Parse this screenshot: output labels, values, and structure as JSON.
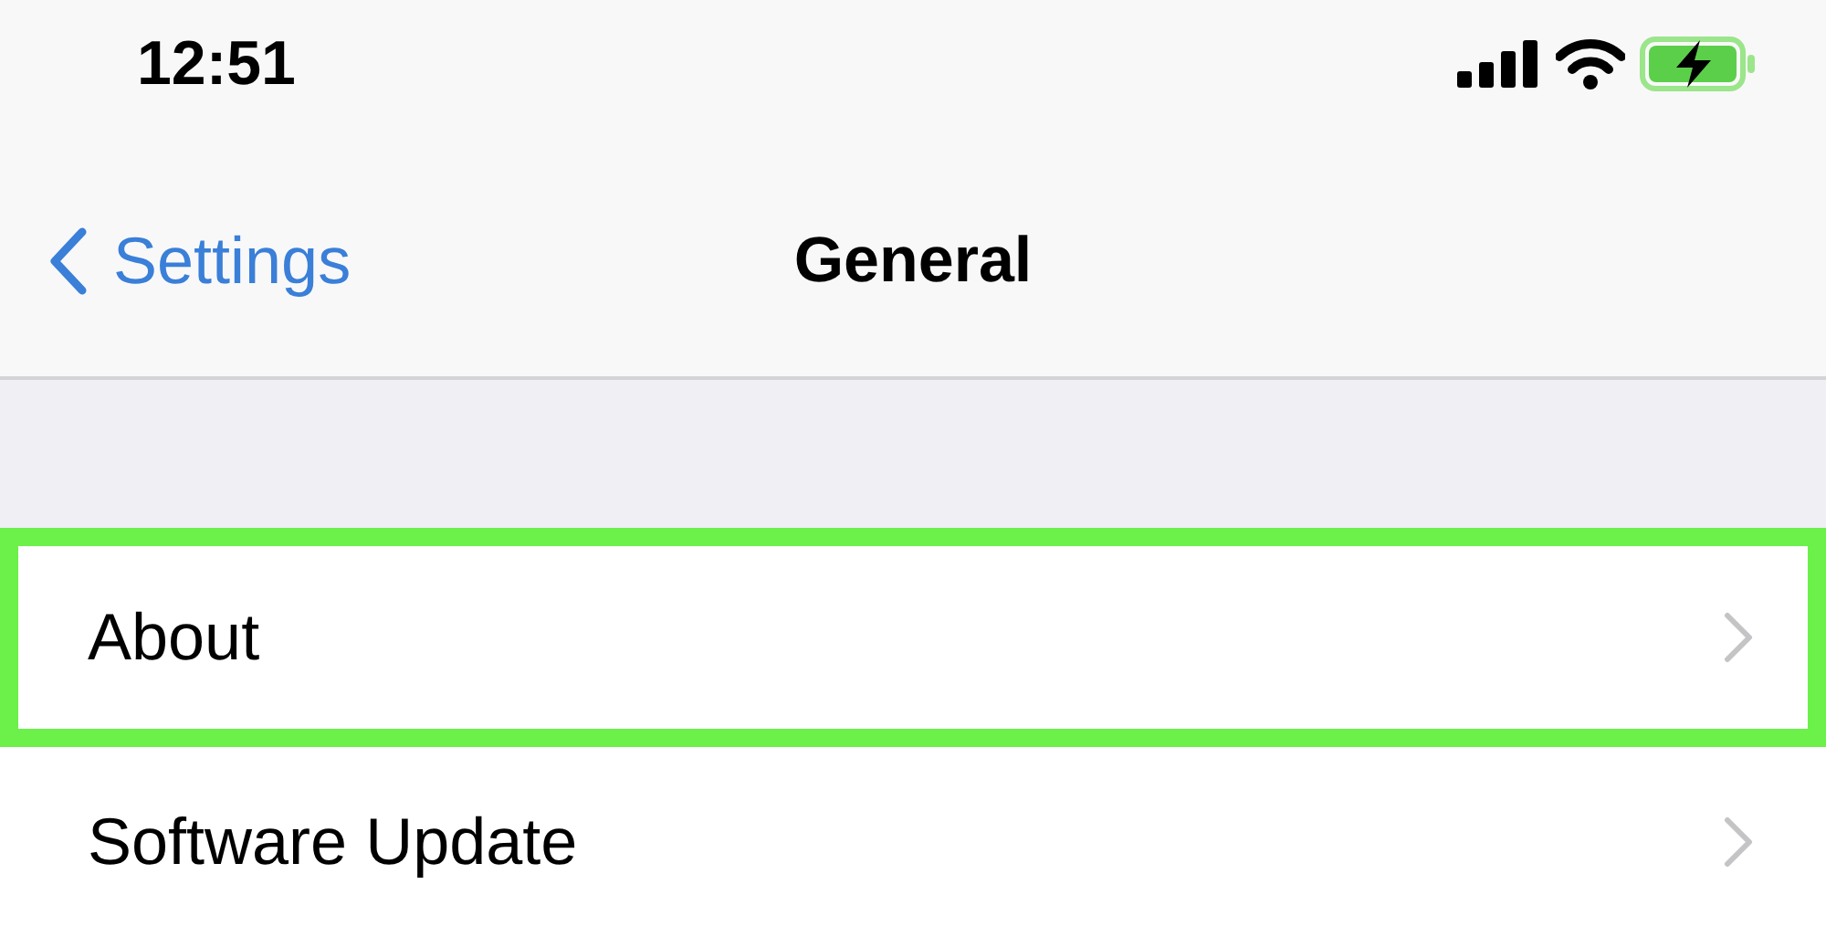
{
  "status_bar": {
    "time": "12:51"
  },
  "nav_bar": {
    "back": "Settings",
    "title": "General"
  },
  "rows": [
    {
      "label": "About",
      "highlighted": true
    },
    {
      "label": "Software Update",
      "highlighted": false
    }
  ]
}
